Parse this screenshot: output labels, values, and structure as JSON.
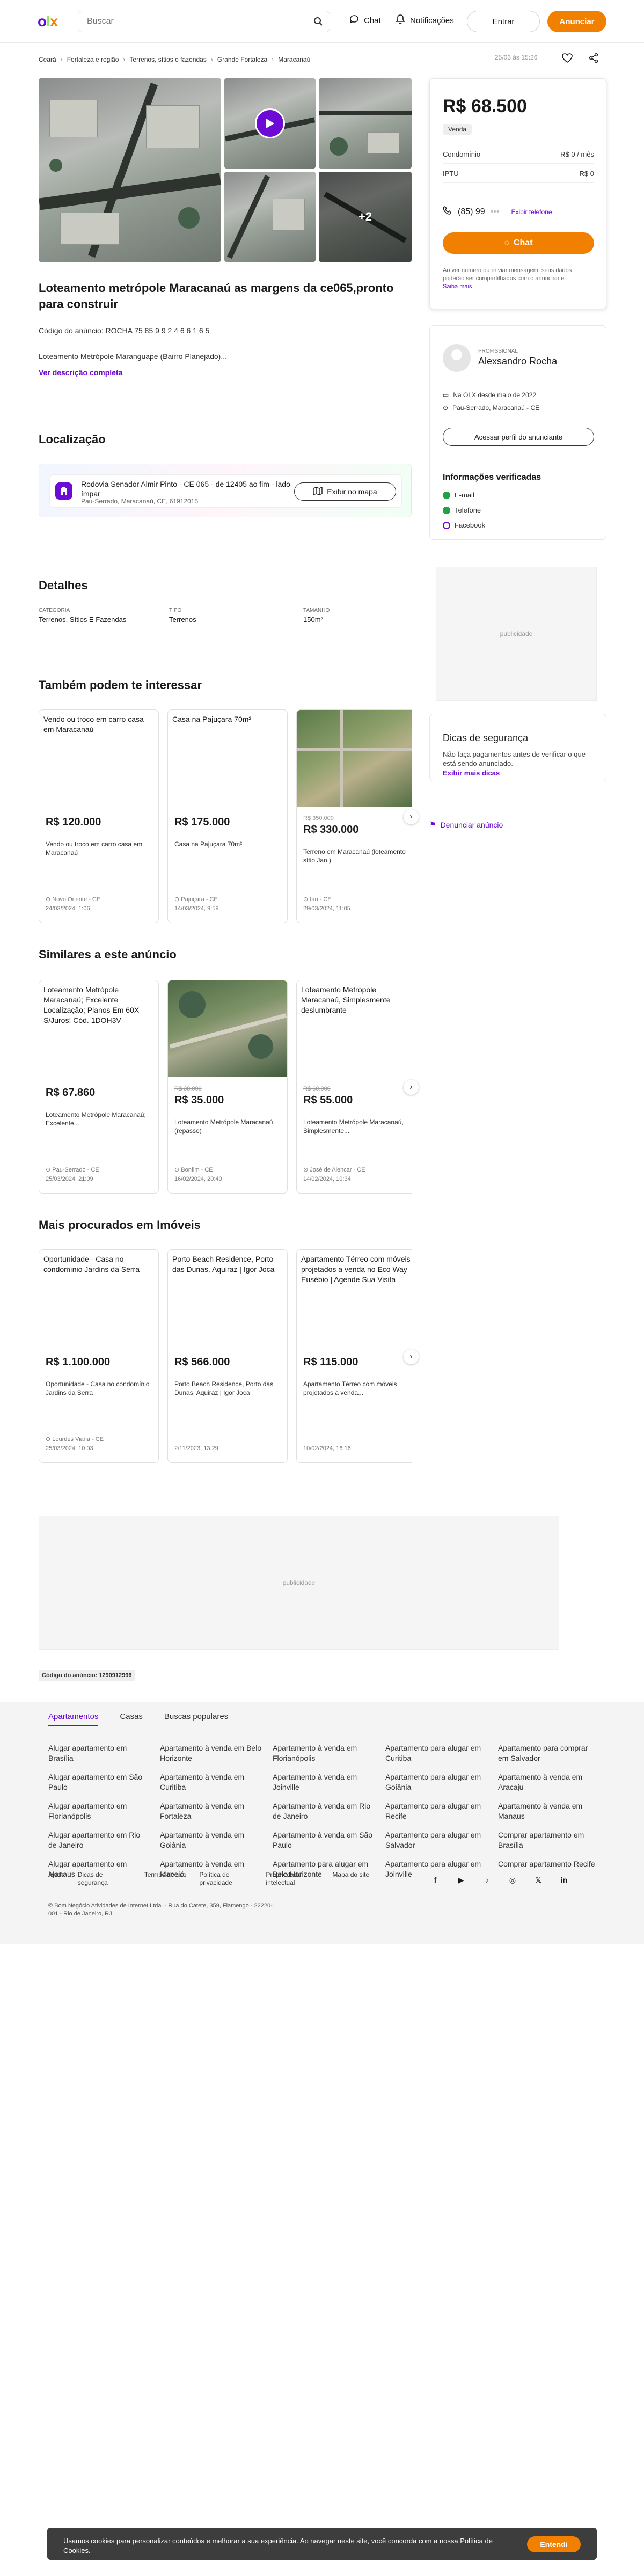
{
  "header": {
    "logo": {
      "o": "o",
      "l": "l",
      "x": "x"
    },
    "search_placeholder": "Buscar",
    "chat": "Chat",
    "notifications": "Notificações",
    "login": "Entrar",
    "announce": "Anunciar"
  },
  "breadcrumbs": [
    "Ceará",
    "Fortaleza e região",
    "Terrenos, sítios e fazendas",
    "Grande Fortaleza",
    "Maracanaú"
  ],
  "topbar": {
    "date": "25/03 às 15:26"
  },
  "gallery": {
    "more_count": "+2"
  },
  "listing": {
    "title": "Loteamento metrópole Maracanaú as margens da ce065,pronto para construir",
    "code": "Código do anúncio: ROCHA 75 85 9 9 2 4 6 6 1 6 5",
    "description": "Loteamento Metrópole Maranguape (Bairro Planejado)...",
    "description_link": "Ver descrição completa"
  },
  "location": {
    "heading": "Localização",
    "address": "Rodovia Senador Almir Pinto - CE 065 - de 12405 ao fim - lado ímpar",
    "city": "Pau-Serrado, Maracanaú, CE, 61912015",
    "map_button": "Exibir no mapa"
  },
  "details": {
    "heading": "Detalhes",
    "items": [
      {
        "label": "Categoria",
        "value": "Terrenos, Sítios E Fazendas"
      },
      {
        "label": "Tipo",
        "value": "Terrenos"
      },
      {
        "label": "Tamanho",
        "value": "150m²"
      }
    ]
  },
  "related": {
    "heading": "Também podem te interessar",
    "cards": [
      {
        "title": "Vendo ou troco em carro casa em Maracanaú",
        "old": "",
        "price": "R$ 120.000",
        "desc": "Vendo ou troco em carro casa em Maracanaú",
        "loc": "Novo Oriente - CE",
        "date": "24/03/2024, 1:06"
      },
      {
        "title": "Casa na Pajuçara 70m²",
        "old": "",
        "price": "R$ 175.000",
        "desc": "Casa na Pajuçara 70m²",
        "loc": "Pajuçara - CE",
        "date": "14/03/2024, 9:59"
      },
      {
        "title": "",
        "old": "R$ 350.000",
        "price": "R$ 330.000",
        "desc": "Terreno em Maracanaú (loteamento sítio Jan.)",
        "loc": "Iari - CE",
        "date": "29/03/2024, 11:05"
      }
    ]
  },
  "similar": {
    "heading": "Similares a este anúncio",
    "cards": [
      {
        "title": "Loteamento Metrópole Maracanaú; Excelente Localização; Planos Em 60X S/Juros! Cód. 1DOH3V",
        "old": "",
        "price": "R$ 67.860",
        "desc": "Loteamento Metrópole Maracanaú; Excelente...",
        "loc": "Pau-Serrado - CE",
        "date": "25/03/2024, 21:09"
      },
      {
        "title": "",
        "old": "R$ 38.000",
        "price": "R$ 35.000",
        "desc": "Loteamento Metrópole Maracanaú (repasso)",
        "loc": "Bonfim - CE",
        "date": "16/02/2024, 20:40"
      },
      {
        "title": "Loteamento Metrópole Maracanaú, Simplesmente deslumbrante",
        "old": "R$ 60.000",
        "price": "R$ 55.000",
        "desc": "Loteamento Metrópole Maracanaú, Simplesmente...",
        "loc": "José de Alencar - CE",
        "date": "14/02/2024, 10:34"
      }
    ]
  },
  "popular": {
    "heading": "Mais procurados em Imóveis",
    "cards": [
      {
        "title": "Oportunidade - Casa no condomínio Jardins da Serra",
        "old": "",
        "price": "R$ 1.100.000",
        "desc": "Oportunidade - Casa no condomínio Jardins da Serra",
        "loc": "Lourdes Viana - CE",
        "date": "25/03/2024, 10:03"
      },
      {
        "title": "Porto Beach Residence, Porto das Dunas, Aquiraz | Igor Joca",
        "old": "",
        "price": "R$ 566.000",
        "desc": "Porto Beach Residence, Porto das Dunas, Aquiraz | Igor Joca",
        "loc": "",
        "date": "2/11/2023, 13:29"
      },
      {
        "title": "Apartamento Térreo com móveis projetados a venda no Eco Way Eusébio | Agende Sua Visita",
        "old": "",
        "price": "R$ 115.000",
        "desc": "Apartamento Térreo com móveis projetados a venda...",
        "loc": "",
        "date": "10/02/2024, 16:16"
      }
    ]
  },
  "sidebar": {
    "price": "R$ 68.500",
    "tag": "Venda",
    "condo_label": "Condomínio",
    "condo_value": "R$ 0 / mês",
    "iptu_label": "IPTU",
    "iptu_value": "R$ 0",
    "phone": "(85) 99",
    "phone_link": "Exibir telefone",
    "chat_button": "Chat",
    "note": "Ao ver número ou enviar mensagem, seus dados poderão ser compartilhados com o anunciante.",
    "note_link": "Saiba mais",
    "seller_kind": "PROFISSIONAL",
    "seller_name": "Alexsandro Rocha",
    "since": "Na OLX desde maio de 2022",
    "seller_loc": "Pau-Serrado, Maracanaú - CE",
    "profile_button": "Acessar perfil do anunciante",
    "verified_heading": "Informações verificadas",
    "verified": [
      "E-mail",
      "Telefone",
      "Facebook"
    ],
    "ad_label": "publicidade",
    "safety_heading": "Dicas de segurança",
    "safety_text": "Não faça pagamentos antes de verificar o que está sendo anunciado.",
    "safety_link": "Exibir mais dicas",
    "report": "Denunciar anúncio"
  },
  "bottom_ad": {
    "label": "publicidade"
  },
  "ad_code": "Código do anúncio: 1290912996",
  "footer": {
    "tabs": [
      "Apartamentos",
      "Casas",
      "Buscas populares"
    ],
    "columns": [
      [
        "Alugar apartamento em Brasília",
        "Alugar apartamento em São Paulo",
        "Alugar apartamento em Florianópolis",
        "Alugar apartamento em Rio de Janeiro",
        "Alugar apartamento em Manaus"
      ],
      [
        "Apartamento à venda em Belo Horizonte",
        "Apartamento à venda em Curitiba",
        "Apartamento à venda em Fortaleza",
        "Apartamento à venda em Goiânia",
        "Apartamento à venda em Maceió"
      ],
      [
        "Apartamento à venda em Florianópolis",
        "Apartamento à venda em Joinville",
        "Apartamento à venda em Rio de Janeiro",
        "Apartamento à venda em São Paulo",
        "Apartamento para alugar em Belo Horizonte"
      ],
      [
        "Apartamento para alugar em Curitiba",
        "Apartamento para alugar em Goiânia",
        "Apartamento para alugar em Recife",
        "Apartamento para alugar em Salvador",
        "Apartamento para alugar em Joinville"
      ],
      [
        "Apartamento para comprar em Salvador",
        "Apartamento à venda em Aracaju",
        "Apartamento à venda em Manaus",
        "Comprar apartamento em Brasília",
        "Comprar apartamento Recife"
      ]
    ],
    "links": [
      "Ajuda",
      "Dicas de segurança",
      "Termos de uso",
      "Política de privacidade",
      "Propriedade intelectual",
      "Mapa do site"
    ],
    "social": [
      "f",
      "▶",
      "♪",
      "◎",
      "𝕏",
      "in"
    ],
    "copyright": "© Bom Negócio Atividades de Internet Ltda. - Rua do Catete, 359, Flamengo - 22220-001 - Rio de Janeiro, RJ"
  },
  "cookie": {
    "text": "Usamos cookies para personalizar conteúdos e melhorar a sua experiência. Ao navegar neste site, você concorda com a nossa Política de Cookies.",
    "button": "Entendi"
  }
}
